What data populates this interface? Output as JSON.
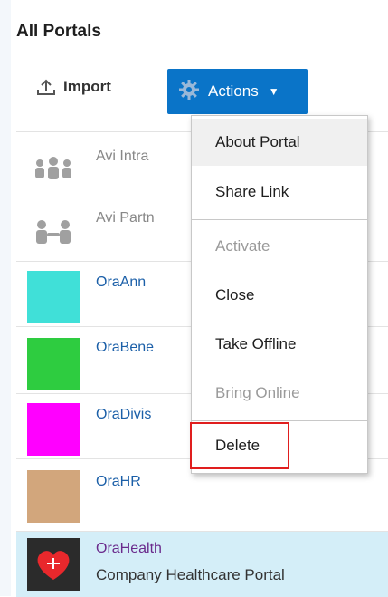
{
  "page": {
    "title": "All Portals"
  },
  "toolbar": {
    "import_label": "Import",
    "import_icon": "upload-icon",
    "actions_label": "Actions",
    "actions_icon": "gear-icon",
    "actions_caret_icon": "caret-down-icon",
    "accent": "#0a74c8"
  },
  "portals": [
    {
      "name": "Avi Intra",
      "thumb": "group-icon"
    },
    {
      "name": "Avi Partn",
      "thumb": "partners-icon"
    },
    {
      "name": "OraAnn",
      "color": "#40e0d8"
    },
    {
      "name": "OraBene",
      "color": "#2ecc40"
    },
    {
      "name": "OraDivis",
      "color": "#ff00ff"
    },
    {
      "name": "OraHR",
      "color": "#d2a67c"
    },
    {
      "name": "OraHealth",
      "subtitle": "Company Healthcare Portal",
      "thumb": "heart-icon"
    }
  ],
  "menu": {
    "items": [
      {
        "label": "About Portal",
        "enabled": true
      },
      {
        "label": "Share Link",
        "enabled": true
      },
      {
        "label": "Activate",
        "enabled": false
      },
      {
        "label": "Close",
        "enabled": true
      },
      {
        "label": "Take Offline",
        "enabled": true
      },
      {
        "label": "Bring Online",
        "enabled": false
      },
      {
        "label": "Delete",
        "enabled": true,
        "highlighted": true
      }
    ],
    "highlight_color": "#e01e1e"
  }
}
